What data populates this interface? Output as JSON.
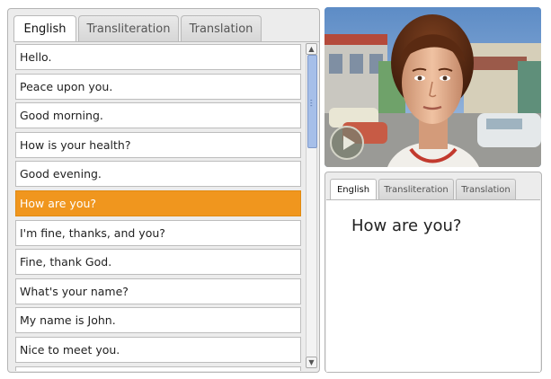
{
  "left_tabs": [
    {
      "label": "English",
      "active": true
    },
    {
      "label": "Transliteration",
      "active": false
    },
    {
      "label": "Translation",
      "active": false
    }
  ],
  "phrases": [
    "Hello.",
    "Peace upon you.",
    "Good morning.",
    "How is your health?",
    "Good evening.",
    "How are you?",
    "I'm fine, thanks, and you?",
    "Fine, thank God.",
    "What's your name?",
    "My name is John.",
    "Nice to meet you."
  ],
  "selected_index": 5,
  "scrollbar": {
    "position_fraction": 0.0,
    "visible_fraction": 0.31
  },
  "video": {
    "play_icon": "play-icon"
  },
  "right_tabs": [
    {
      "label": "English",
      "active": true
    },
    {
      "label": "Transliteration",
      "active": false
    },
    {
      "label": "Translation",
      "active": false
    }
  ],
  "current_phrase": "How are you?",
  "colors": {
    "selected_row": "#f0961e",
    "scroll_thumb": "#a6bfe9"
  }
}
